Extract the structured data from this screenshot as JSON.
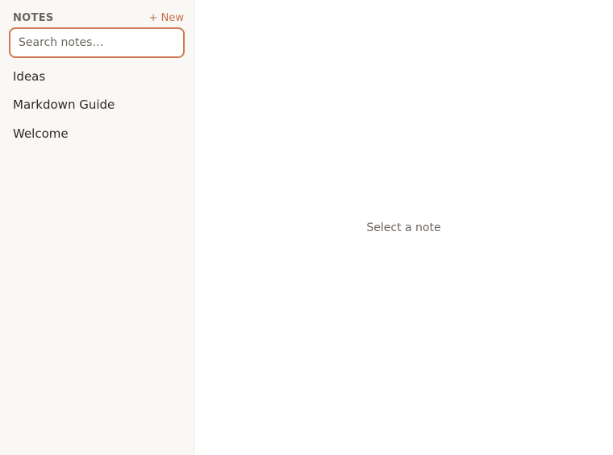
{
  "sidebar": {
    "title": "NOTES",
    "new_label": "+ New",
    "search": {
      "placeholder": "Search notes…",
      "value": ""
    },
    "notes": [
      {
        "title": "Ideas"
      },
      {
        "title": "Markdown Guide"
      },
      {
        "title": "Welcome"
      }
    ]
  },
  "main": {
    "empty_message": "Select a note"
  },
  "colors": {
    "accent": "#c4704a",
    "sidebar_bg": "#faf8f5",
    "text": "#2c2926",
    "muted": "#6b655e"
  }
}
